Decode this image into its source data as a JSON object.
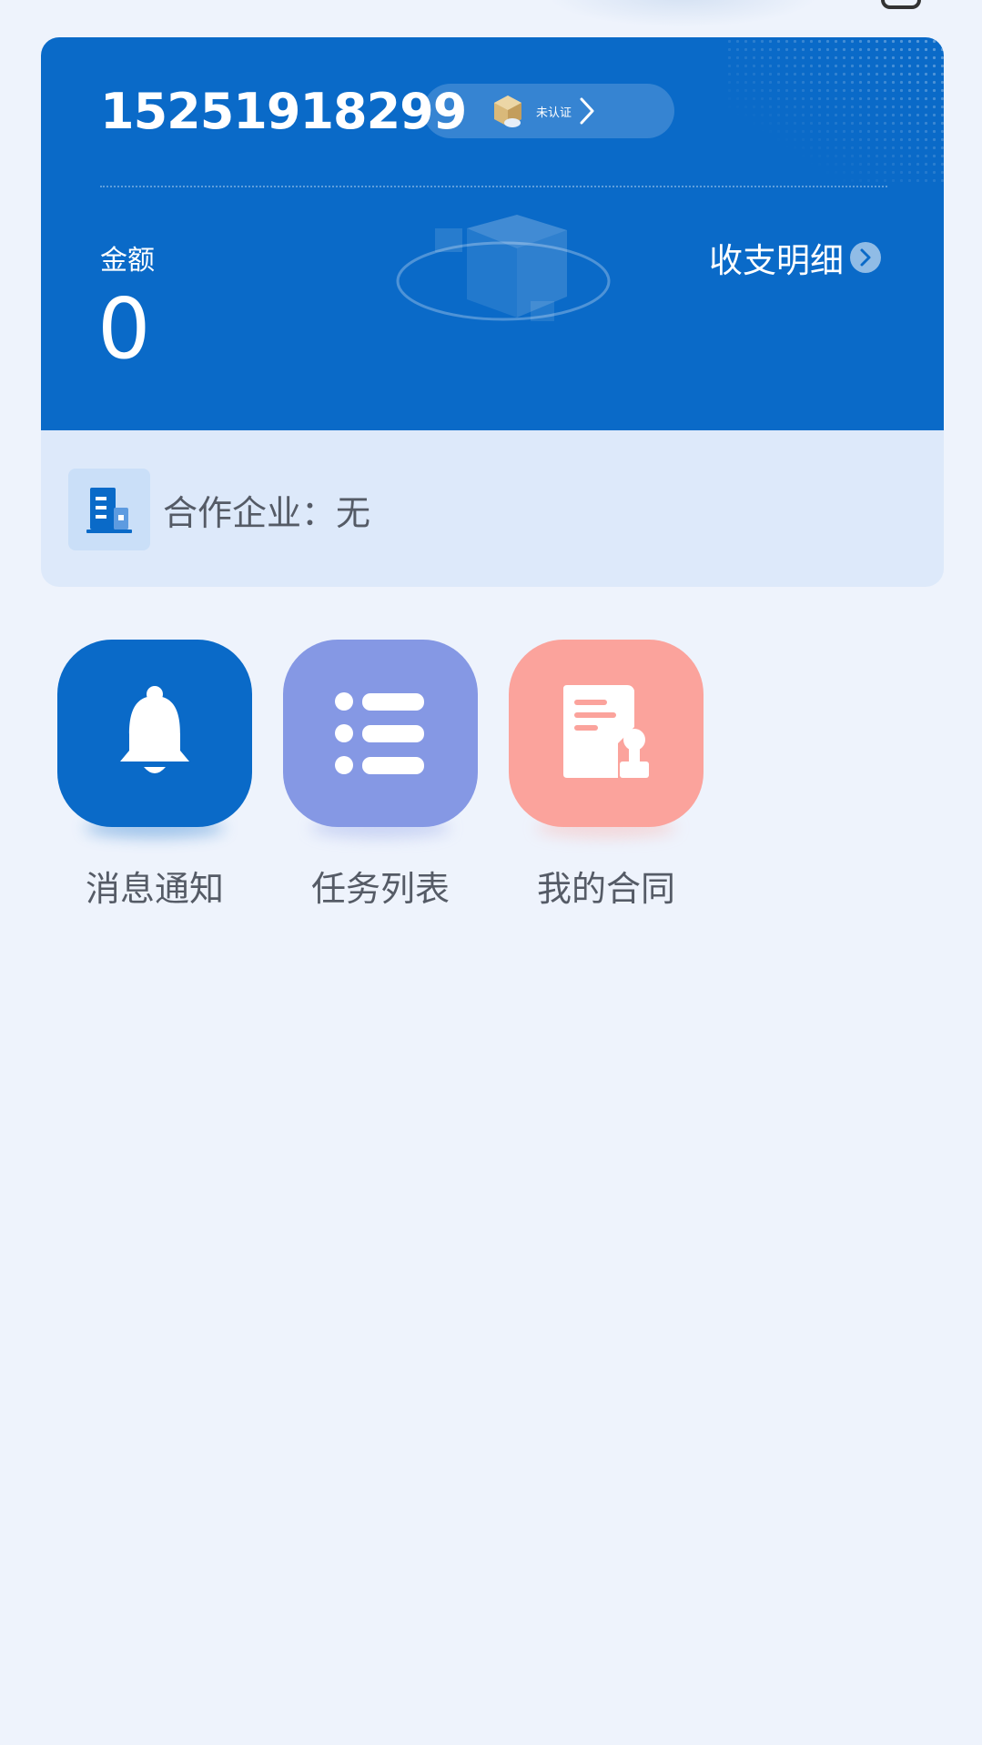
{
  "account": {
    "phone": "15251918299",
    "verify_status": "未认证"
  },
  "balance": {
    "label": "金额",
    "value": "0",
    "detail_link": "收支明细"
  },
  "partner": {
    "text": "合作企业：无"
  },
  "menu": [
    {
      "label": "消息通知",
      "icon": "bell-icon",
      "color": "#0a6ac8"
    },
    {
      "label": "任务列表",
      "icon": "list-icon",
      "color": "#8598e4"
    },
    {
      "label": "我的合同",
      "icon": "contract-icon",
      "color": "#fba39c"
    }
  ],
  "colors": {
    "primary": "#0a6ac8",
    "background": "#eef3fc",
    "card_bottom": "#dde9fa",
    "text_gray": "#555b66"
  }
}
